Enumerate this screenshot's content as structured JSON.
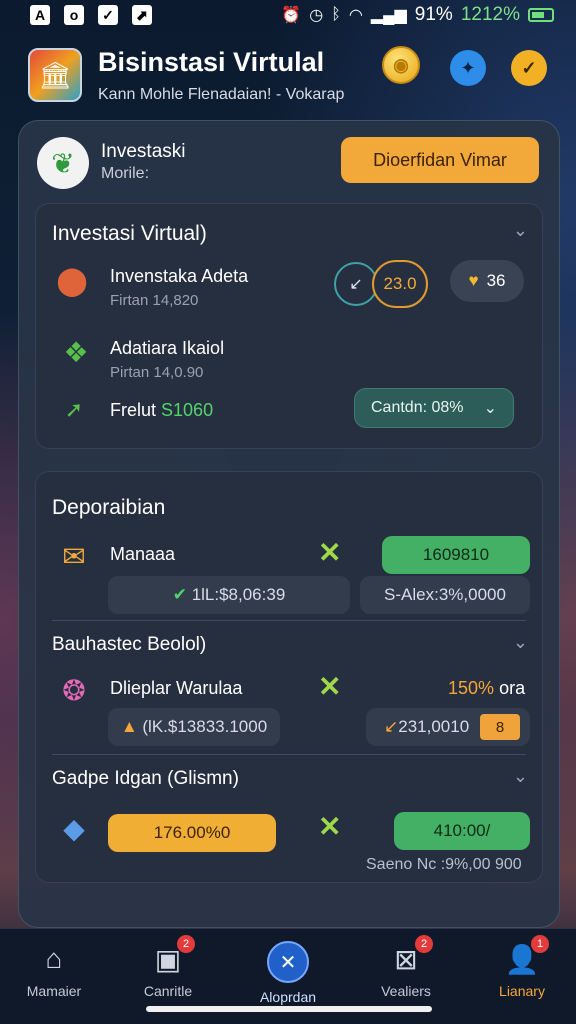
{
  "status_bar": {
    "left_icons": [
      "A",
      "o",
      "✓",
      "⬈"
    ],
    "battery_text": "91%",
    "time_text": "1212%"
  },
  "header": {
    "title": "Bisinstasi Virtulal",
    "subtitle": "Kann Mohle Flenadaian! - Vokarap"
  },
  "profile": {
    "name": "Investaski",
    "subtitle": "Morile:",
    "primary_button": "Dioerfidan Vimar"
  },
  "investasi_card": {
    "title": "Investasi Virtual)",
    "row1": {
      "title": "Invenstaka Adeta",
      "sub": "Firtan 14,820",
      "ring_a": "↙",
      "ring_b": "23.0",
      "heart_value": "36"
    },
    "row2": {
      "title": "Adatiara Ikaiol",
      "sub": "Pirtan 14,0.90"
    },
    "row3": {
      "label": "Frelut",
      "value": "S1060",
      "select_value": "Cantdn: 08%"
    }
  },
  "deporaibian_card": {
    "title": "Deporaibian",
    "row1": {
      "title": "Manaaa",
      "bar_green": "1609810",
      "bar_left": "1lL:$8,06:39",
      "bar_right": "S-Alex:3%,0000"
    },
    "section2_title": "Bauhastec Beolol)",
    "row2": {
      "title": "Dlieplar Warulaa",
      "value_orange": "150%",
      "value_suffix": "ora",
      "bar_left": "(lK.$13833.1000",
      "bar_right": "231,0010",
      "badge": "8"
    },
    "section3_title": "Gadpe Idgan (Glismn)",
    "row3": {
      "bar_orange": "176.00%0",
      "bar_green": "410:00/",
      "footer": "Saeno Nc :9%,00 900"
    }
  },
  "bottom_nav": [
    {
      "label": "Mamaier",
      "badge": ""
    },
    {
      "label": "Canritle",
      "badge": "2"
    },
    {
      "label": "Aloprdan",
      "badge": ""
    },
    {
      "label": "Vealiers",
      "badge": "2"
    },
    {
      "label": "Lianary",
      "badge": "1"
    }
  ]
}
